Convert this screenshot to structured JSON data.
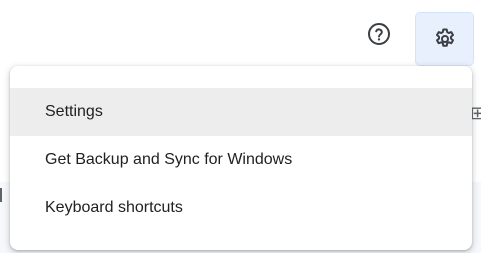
{
  "header": {
    "help_icon": "help-circle-icon",
    "settings_icon": "gear-icon"
  },
  "menu": {
    "items": [
      {
        "label": "Settings",
        "active": true
      },
      {
        "label": "Get Backup and Sync for Windows",
        "active": false
      },
      {
        "label": "Keyboard shortcuts",
        "active": false
      }
    ]
  },
  "colors": {
    "active_item_bg": "#ededed",
    "settings_button_bg": "#e8f0fe",
    "text": "#202124",
    "icon": "#5f6368"
  }
}
